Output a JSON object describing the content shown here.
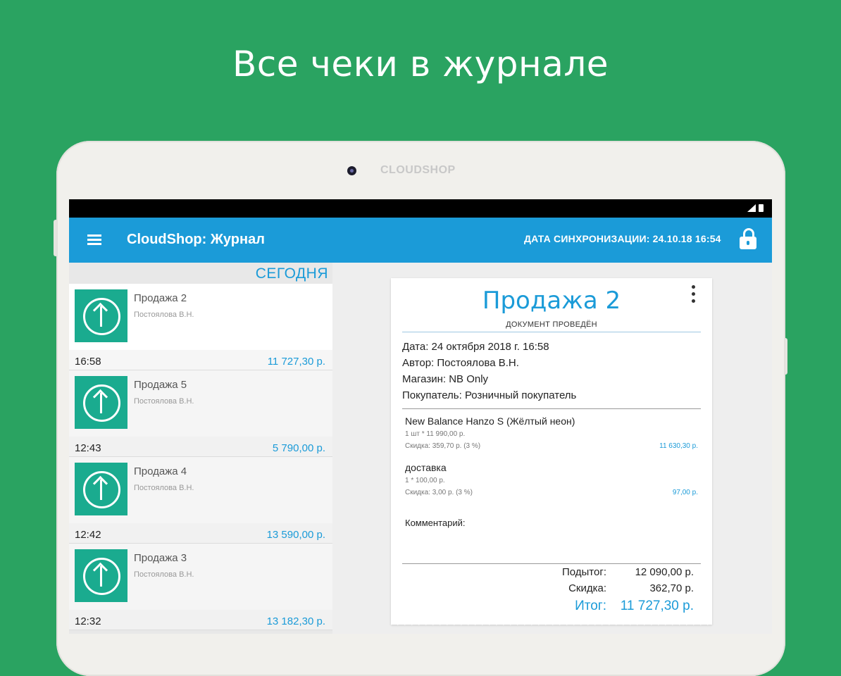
{
  "headline": "Все чеки в журнале",
  "device": {
    "brand": "CLOUDSHOP"
  },
  "appbar": {
    "title": "CloudShop: Журнал",
    "sync": "ДАТА СИНХРОНИЗАЦИИ: 24.10.18 16:54",
    "menu_icon": "hamburger-icon",
    "lock_icon": "lock-icon"
  },
  "list": {
    "section": "СЕГОДНЯ",
    "items": [
      {
        "title": "Продажа 2",
        "author": "Постоялова В.Н.",
        "time": "16:58",
        "sum": "11 727,30 р."
      },
      {
        "title": "Продажа 5",
        "author": "Постоялова В.Н.",
        "time": "12:43",
        "sum": "5 790,00 р."
      },
      {
        "title": "Продажа 4",
        "author": "Постоялова В.Н.",
        "time": "12:42",
        "sum": "13 590,00 р."
      },
      {
        "title": "Продажа 3",
        "author": "Постоялова В.Н.",
        "time": "12:32",
        "sum": "13 182,30 р."
      }
    ]
  },
  "receipt": {
    "title": "Продажа 2",
    "status": "ДОКУМЕНТ ПРОВЕДЁН",
    "date": "Дата: 24 октября 2018 г. 16:58",
    "author": "Автор: Постоялова В.Н.",
    "store": "Магазин: NB Only",
    "customer": "Покупатель: Розничный покупатель",
    "products": [
      {
        "name": "New Balance Hanzo S (Жёлтый неон)",
        "qty": "1 шт * 11 990,00 р.",
        "discount": "Скидка: 359,70 р. (3 %)",
        "sum": "11 630,30 р."
      },
      {
        "name": "доставка",
        "qty": "1 * 100,00 р.",
        "discount": "Скидка: 3,00 р. (3 %)",
        "sum": "97,00 р."
      }
    ],
    "comment_label": "Комментарий:",
    "subtotal_label": "Подытог:",
    "subtotal": "12 090,00 р.",
    "discount_label": "Скидка:",
    "discount": "362,70 р.",
    "total_label": "Итог:",
    "total": "11 727,30 р."
  },
  "colors": {
    "background": "#2aa361",
    "accent": "#1b9bd8",
    "thumb": "#1aab8f"
  }
}
